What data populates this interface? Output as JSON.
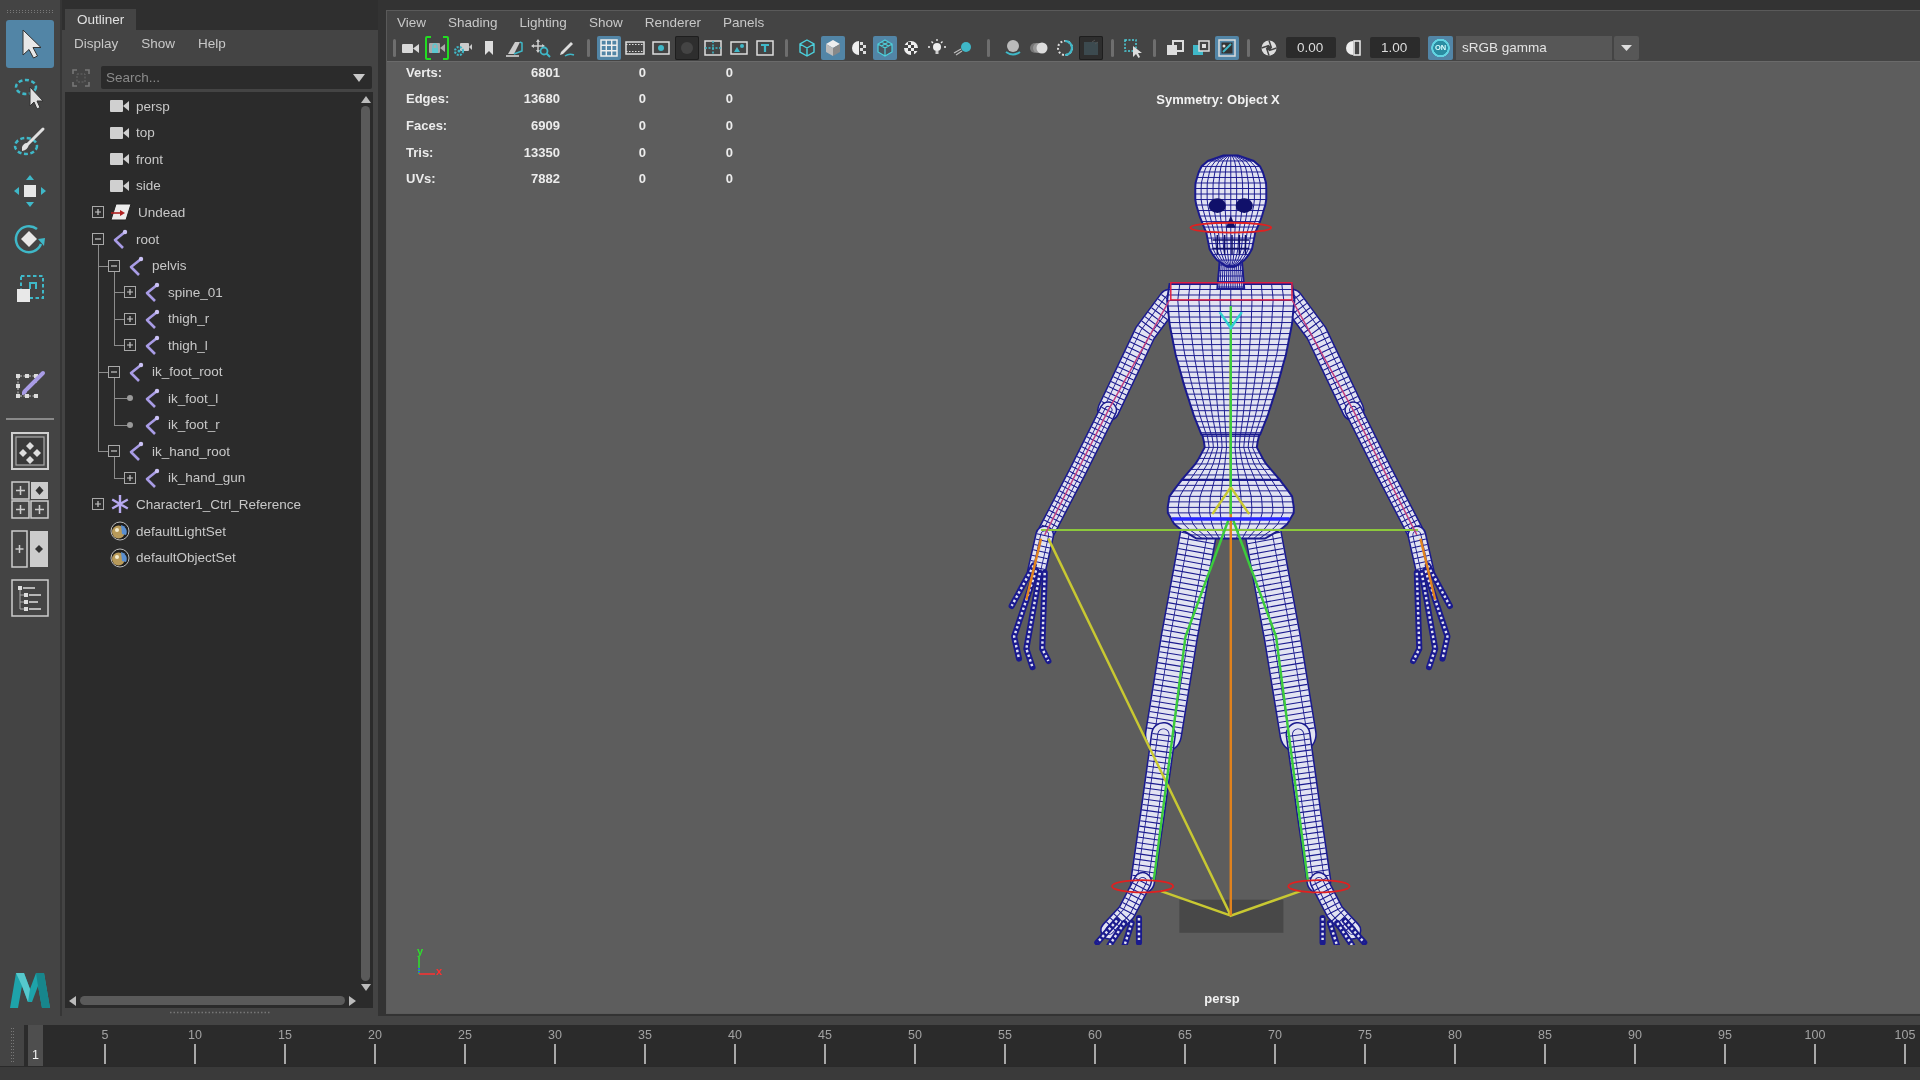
{
  "tool_box": {
    "tools": [
      {
        "selected": true
      },
      {
        "selected": false
      },
      {
        "selected": false
      },
      {
        "selected": false
      },
      {
        "selected": false
      },
      {
        "selected": false
      },
      {
        "selected": false
      }
    ]
  },
  "outliner": {
    "tab": {
      "label": "Outliner",
      "selected": true
    },
    "menus": [
      "Display",
      "Show",
      "Help"
    ],
    "search": {
      "placeholder": "Search..."
    },
    "items": [
      {
        "label": "persp",
        "kind": "camera",
        "selected": false
      },
      {
        "label": "top",
        "kind": "camera",
        "selected": false
      },
      {
        "label": "front",
        "kind": "camera",
        "selected": false
      },
      {
        "label": "side",
        "kind": "camera",
        "selected": false
      },
      {
        "label": "Undead",
        "kind": "mesh",
        "selected": false,
        "expanded": false
      },
      {
        "label": "root",
        "kind": "joint",
        "selected": false,
        "expanded": true,
        "children": [
          {
            "label": "pelvis",
            "kind": "joint",
            "selected": false,
            "expanded": true,
            "children": [
              {
                "label": "spine_01",
                "kind": "joint",
                "selected": false,
                "expanded": false
              },
              {
                "label": "thigh_r",
                "kind": "joint",
                "selected": false,
                "expanded": false
              },
              {
                "label": "thigh_l",
                "kind": "joint",
                "selected": false,
                "expanded": false
              }
            ]
          },
          {
            "label": "ik_foot_root",
            "kind": "joint",
            "selected": false,
            "expanded": true,
            "children": [
              {
                "label": "ik_foot_l",
                "kind": "joint",
                "selected": false
              },
              {
                "label": "ik_foot_r",
                "kind": "joint",
                "selected": false
              }
            ]
          },
          {
            "label": "ik_hand_root",
            "kind": "joint",
            "selected": false,
            "expanded": true,
            "children": [
              {
                "label": "ik_hand_gun",
                "kind": "joint",
                "selected": false,
                "expanded": false
              }
            ]
          }
        ]
      },
      {
        "label": "Character1_Ctrl_Reference",
        "kind": "character",
        "selected": false,
        "expanded": false
      },
      {
        "label": "defaultLightSet",
        "kind": "set",
        "selected": false
      },
      {
        "label": "defaultObjectSet",
        "kind": "set",
        "selected": false
      }
    ]
  },
  "viewport": {
    "menus": [
      "View",
      "Shading",
      "Lighting",
      "Show",
      "Renderer",
      "Panels"
    ],
    "toolbar": {
      "groups": [
        [
          {
            "selected": false,
            "disabled": false,
            "highlighted": false
          },
          {
            "selected": false,
            "disabled": false,
            "highlighted": true
          },
          {
            "selected": false,
            "disabled": false,
            "highlighted": false
          },
          {
            "selected": false,
            "disabled": false,
            "highlighted": false
          },
          {
            "selected": false,
            "disabled": false,
            "highlighted": false
          },
          {
            "selected": false,
            "disabled": false,
            "highlighted": false
          },
          {
            "selected": false,
            "disabled": false,
            "highlighted": false
          }
        ],
        [
          {
            "selected": true,
            "disabled": false,
            "highlighted": false
          },
          {
            "selected": false,
            "disabled": false,
            "highlighted": false
          },
          {
            "selected": false,
            "disabled": false,
            "highlighted": false
          },
          {
            "selected": false,
            "disabled": true,
            "highlighted": false
          },
          {
            "selected": false,
            "disabled": false,
            "highlighted": false
          },
          {
            "selected": false,
            "disabled": false,
            "highlighted": false
          },
          {
            "selected": false,
            "disabled": false,
            "highlighted": false
          }
        ],
        [
          {
            "selected": false,
            "disabled": false,
            "highlighted": false
          },
          {
            "selected": true,
            "disabled": false,
            "highlighted": false
          },
          {
            "selected": false,
            "disabled": false,
            "highlighted": false
          },
          {
            "selected": true,
            "disabled": false,
            "highlighted": false
          },
          {
            "selected": false,
            "disabled": false,
            "highlighted": false
          },
          {
            "selected": false,
            "disabled": false,
            "highlighted": false
          },
          {
            "selected": false,
            "disabled": false,
            "highlighted": false
          }
        ],
        [
          {
            "selected": false,
            "disabled": false,
            "highlighted": false
          },
          {
            "selected": false,
            "disabled": false,
            "highlighted": false
          },
          {
            "selected": false,
            "disabled": false,
            "highlighted": false
          },
          {
            "selected": false,
            "disabled": true,
            "highlighted": false
          }
        ],
        [
          {
            "selected": false,
            "disabled": false,
            "highlighted": false
          }
        ],
        [
          {
            "selected": false,
            "disabled": false,
            "highlighted": false
          },
          {
            "selected": false,
            "disabled": false,
            "highlighted": false
          },
          {
            "selected": true,
            "disabled": false,
            "highlighted": false
          }
        ]
      ],
      "exposure": "0.00",
      "gamma": "1.00",
      "color_management": {
        "label": "ON",
        "on": true
      },
      "view_transform": "sRGB gamma"
    },
    "hud": {
      "rows": [
        {
          "label": "Verts:",
          "values": [
            "6801",
            "0",
            "0"
          ]
        },
        {
          "label": "Edges:",
          "values": [
            "13680",
            "0",
            "0"
          ]
        },
        {
          "label": "Faces:",
          "values": [
            "6909",
            "0",
            "0"
          ]
        },
        {
          "label": "Tris:",
          "values": [
            "13350",
            "0",
            "0"
          ]
        },
        {
          "label": "UVs:",
          "values": [
            "7882",
            "0",
            "0"
          ]
        }
      ]
    },
    "symmetry": "Symmetry: Object X",
    "camera": "persp",
    "axis": {
      "y": "y",
      "x": "x"
    }
  },
  "timeline": {
    "current_frame": "1",
    "level": 0,
    "frame_labels": [
      "5",
      "10",
      "15",
      "20",
      "25",
      "30",
      "35",
      "40",
      "45",
      "50",
      "55",
      "60",
      "65",
      "70",
      "75",
      "80",
      "85",
      "90",
      "95",
      "100",
      "105"
    ]
  }
}
